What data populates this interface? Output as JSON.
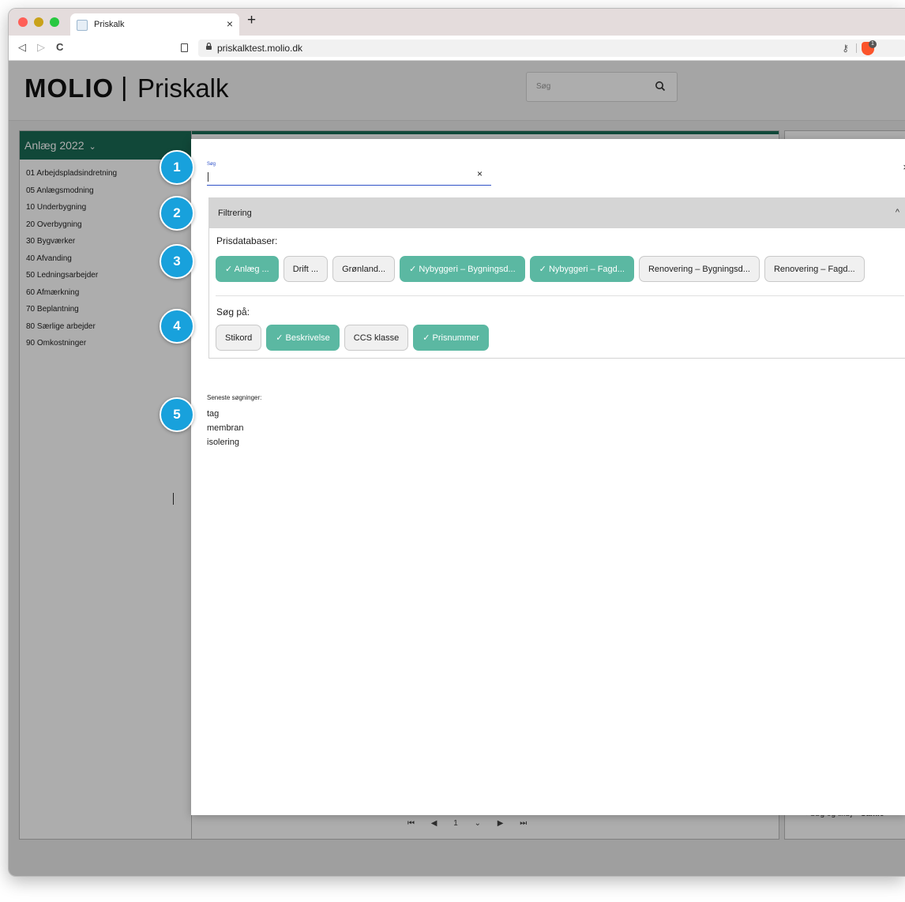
{
  "browser": {
    "tab_title": "Priskalk",
    "tab_close": "×",
    "new_tab": "+",
    "nav_back": "◁",
    "nav_forward": "▷",
    "nav_reload": "C",
    "bookmark": "⃞",
    "url": "priskalktest.molio.dk",
    "key_icon": "⚷",
    "brave_badge": "1"
  },
  "header": {
    "logo_brand": "MOLIO",
    "logo_sep": "|",
    "logo_product": "Priskalk",
    "search_placeholder": "Søg"
  },
  "sidebar": {
    "title": "Anlæg 2022",
    "chevron": "⌄",
    "items": [
      {
        "label": "01 Arbejdspladsindretning"
      },
      {
        "label": "05 Anlægsmodning"
      },
      {
        "label": "10 Underbygning"
      },
      {
        "label": "20 Overbygning"
      },
      {
        "label": "30 Bygværker"
      },
      {
        "label": "40 Afvanding"
      },
      {
        "label": "50 Ledningsarbejder"
      },
      {
        "label": "60 Afmærkning"
      },
      {
        "label": "70 Beplantning"
      },
      {
        "label": "80 Særlige arbejder"
      },
      {
        "label": "90 Omkostninger"
      }
    ]
  },
  "pager": {
    "first": "⏮",
    "prev": "◀",
    "page": "1",
    "page_chev": "⌄",
    "next": "▶",
    "last": "⏭"
  },
  "right_footer": {
    "search_add": "Søg og tilføj",
    "bold_label": "Samle"
  },
  "modal": {
    "close": "×",
    "search_label": "Søg",
    "search_value": "",
    "clear": "×",
    "filter_title": "Filtrering",
    "filter_chevron": "^",
    "databases_label": "Prisdatabaser:",
    "databases": [
      {
        "label": "✓ Anlæg ...",
        "selected": true
      },
      {
        "label": "Drift ...",
        "selected": false
      },
      {
        "label": "Grønland...",
        "selected": false
      },
      {
        "label": "✓ Nybyggeri – Bygningsd...",
        "selected": true
      },
      {
        "label": "✓ Nybyggeri – Fagd...",
        "selected": true
      },
      {
        "label": "Renovering – Bygningsd...",
        "selected": false
      },
      {
        "label": "Renovering – Fagd...",
        "selected": false
      }
    ],
    "search_on_label": "Søg på:",
    "search_on": [
      {
        "label": "Stikord",
        "selected": false
      },
      {
        "label": "✓ Beskrivelse",
        "selected": true
      },
      {
        "label": "CCS klasse",
        "selected": false
      },
      {
        "label": "✓ Prisnummer",
        "selected": true
      }
    ],
    "recent_label": "Seneste søgninger:",
    "recent": [
      {
        "label": "tag"
      },
      {
        "label": "membran"
      },
      {
        "label": "isolering"
      }
    ]
  },
  "markers": [
    {
      "label": "1"
    },
    {
      "label": "2"
    },
    {
      "label": "3"
    },
    {
      "label": "4"
    },
    {
      "label": "5"
    }
  ],
  "colors": {
    "accent_green": "#1a6a55",
    "chip_selected": "#5bb8a2",
    "marker_blue": "#18a1dc",
    "input_blue": "#2f52c8"
  }
}
